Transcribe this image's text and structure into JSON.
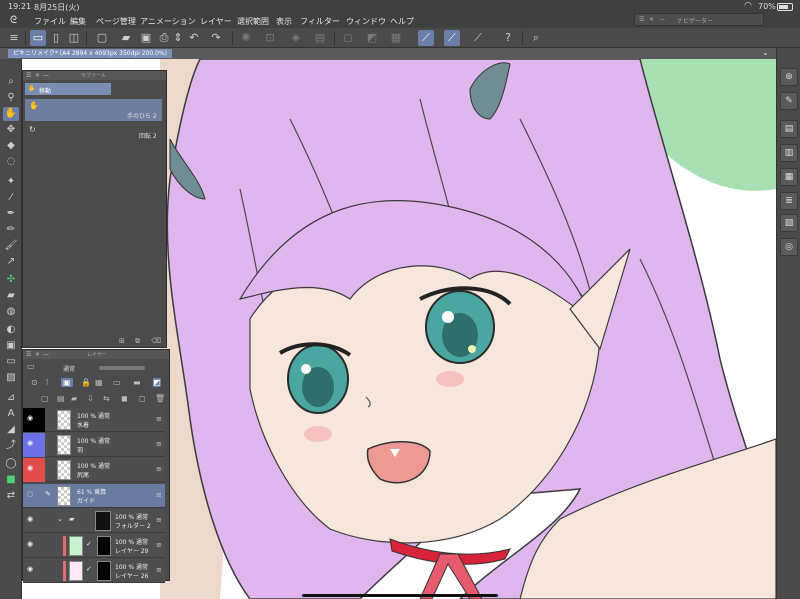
{
  "status": {
    "time": "19:21",
    "date": "8月25日(火)",
    "battery": "70%"
  },
  "menu": {
    "items": [
      "ファイル",
      "編集",
      "ページ管理",
      "アニメーション",
      "レイヤー",
      "選択範囲",
      "表示",
      "フィルター",
      "ウィンドウ",
      "ヘルプ"
    ]
  },
  "navigator": {
    "title": "ナビゲーター"
  },
  "document": {
    "tab_label": "ピキニリメイク* (A4 2894 x 4093px 350dpi 200.0%)"
  },
  "subtool": {
    "title": "サブツール",
    "group": "移動",
    "items": [
      {
        "label": "手のひら 2",
        "selected": true
      },
      {
        "label": "回転 2",
        "selected": false
      }
    ]
  },
  "layers": {
    "title": "レイヤー",
    "blend_mode": "通常",
    "rows": [
      {
        "percent": "100 % 通常",
        "name": "水着",
        "color": "#000000",
        "selected": false
      },
      {
        "percent": "100 % 通常",
        "name": "羽",
        "color": "#6c72e6",
        "selected": false
      },
      {
        "percent": "100 % 通常",
        "name": "尻尾",
        "color": "#e34c4c",
        "selected": false
      },
      {
        "percent": "61 % 乗算",
        "name": "ガイド",
        "color": "#4e4e4e",
        "selected": true
      },
      {
        "percent": "100 % 通常",
        "name": "フォルダー 2",
        "color": "#4e4e4e",
        "selected": false
      },
      {
        "percent": "100 % 通常",
        "name": "レイヤー 29",
        "color": "#4e4e4e",
        "selected": false
      },
      {
        "percent": "100 % 通常",
        "name": "レイヤー 26",
        "color": "#4e4e4e",
        "selected": false
      }
    ]
  },
  "colors": {
    "accent": "#6b7ea8",
    "hair": "#e0b6ef",
    "skin": "#f7e6dc",
    "eyes": "#4aa6a0",
    "background_shape": "#a8dfb3",
    "ribbon": "#d8233a"
  }
}
